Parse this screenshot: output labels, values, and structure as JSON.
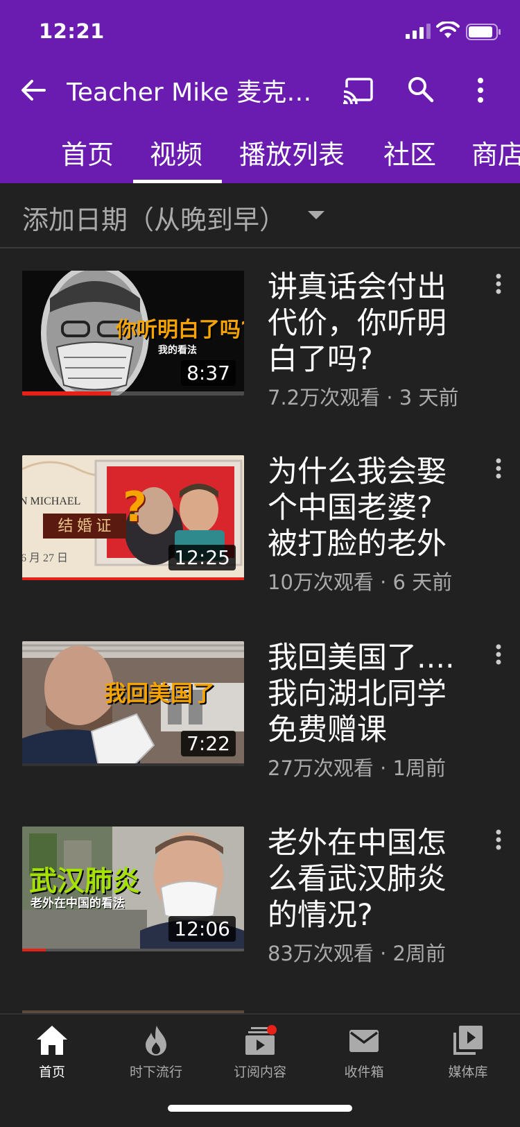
{
  "status": {
    "time": "12:21"
  },
  "appbar": {
    "title": "Teacher Mike 麦克老师"
  },
  "tabs": [
    "首页",
    "视频",
    "播放列表",
    "社区",
    "商店"
  ],
  "active_tab": "视频",
  "sort": {
    "label": "添加日期（从晚到早）"
  },
  "videos": [
    {
      "title": "讲真话会付出代价，你听明白了吗?",
      "meta": "7.2万次观看 · 3 天前",
      "duration": "8:37",
      "thumb_text": "你听明白了吗?",
      "thumb_subtext": "我的看法",
      "watched_fraction": 0.4
    },
    {
      "title": "为什么我会娶个中国老婆? 被打脸的老外",
      "meta": "10万次观看 · 6 天前",
      "duration": "12:25",
      "thumb_text": "结 婚 证",
      "thumb_subtext": "N MICHAEL",
      "thumb_date": "6 月 27 日",
      "watched_fraction": 1.0
    },
    {
      "title": "我回美国了....我向湖北同学免费赠课",
      "meta": "27万次观看 · 1周前",
      "duration": "7:22",
      "thumb_text": "我回美国了",
      "watched_fraction": 0
    },
    {
      "title": "老外在中国怎么看武汉肺炎的情况?",
      "meta": "83万次观看 · 2周前",
      "duration": "12:06",
      "thumb_text": "武汉肺炎",
      "thumb_subtext": "老外在中国的看法",
      "watched_fraction": 0.1
    }
  ],
  "bottom_nav": [
    {
      "label": "首页",
      "icon": "home-icon",
      "active": true
    },
    {
      "label": "时下流行",
      "icon": "trending-icon"
    },
    {
      "label": "订阅内容",
      "icon": "subscriptions-icon",
      "badge": true
    },
    {
      "label": "收件箱",
      "icon": "inbox-icon"
    },
    {
      "label": "媒体库",
      "icon": "library-icon"
    }
  ],
  "colors": {
    "header_bg": "#6a1cb0",
    "page_bg": "#212121",
    "progress": "#e62117",
    "secondary_text": "#aaaaaa"
  }
}
